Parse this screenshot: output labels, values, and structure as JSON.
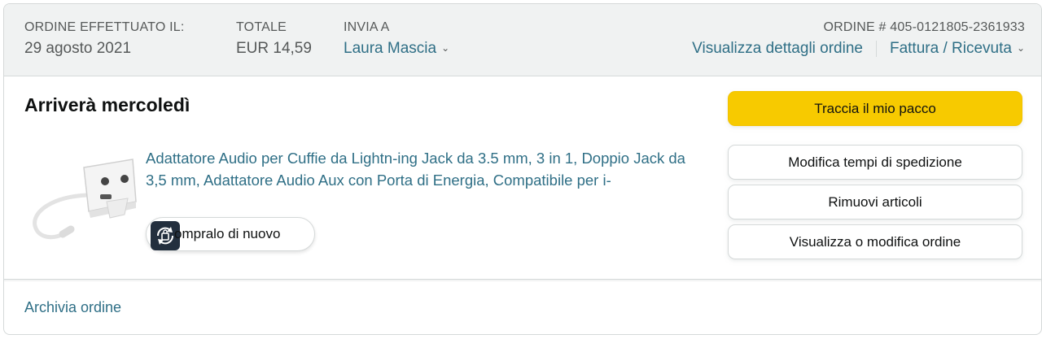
{
  "header": {
    "order_placed_label": "ORDINE EFFETTUATO IL:",
    "order_placed_value": "29 agosto 2021",
    "total_label": "TOTALE",
    "total_value": "EUR 14,59",
    "ship_to_label": "INVIA A",
    "ship_to_value": "Laura Mascia",
    "ship_to_icon": "chevron-down-icon",
    "order_number": "ORDINE # 405-0121805-2361933",
    "details_link": "Visualizza dettagli ordine",
    "invoice_link": "Fattura / Ricevuta",
    "invoice_icon": "chevron-down-icon"
  },
  "shipment": {
    "delivery_status": "Arriverà mercoledì",
    "product": {
      "title": "Adattatore Audio per Cuffie da Lightn-ing Jack da 3.5 mm, 3 in 1, Doppio Jack da 3,5 mm, Adattatore Audio Aux con Porta di Energia, Compatibile per i-",
      "buy_again_label": "ompralo di nuovo",
      "buy_again_icon": "buy-again-icon"
    },
    "actions": {
      "track": "Traccia il mio pacco",
      "change_delivery": "Modifica tempi di spedizione",
      "remove_items": "Rimuovi articoli",
      "view_edit_order": "Visualizza o modifica ordine"
    }
  },
  "footer": {
    "archive_link": "Archivia ordine"
  },
  "colors": {
    "link": "#2f6f86",
    "primary_button": "#f7ca00",
    "header_bg": "#f0f2f2",
    "border": "#d5d9d9"
  }
}
